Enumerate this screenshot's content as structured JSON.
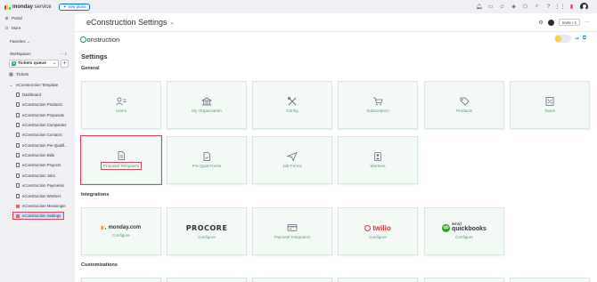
{
  "topbar": {
    "brand_bold": "monday",
    "brand_rest": " service",
    "see_plans": "See plans",
    "icons": [
      "bell-icon",
      "inbox-icon",
      "invite-members-icon",
      "integrations-icon",
      "apps-icon",
      "search-icon",
      "help-icon",
      "app-grid-icon"
    ]
  },
  "sidebar": {
    "portal": "Portal",
    "more": "More",
    "favorites": "Favorites",
    "workspaces": "Workspaces",
    "workspace_name": "Tickets queue",
    "workspace_badge": "S",
    "tickets": "Tickets",
    "template_folder": "eConstruction Template",
    "tree": [
      "Dashboard",
      "eConstruction Products",
      "eConstruction Proposals",
      "eConstruction Companies",
      "eConstruction Contacts",
      "eConstruction Pre-Qualif...",
      "eConstruction Bids",
      "eConstruction Projects",
      "eConstruction Jobs",
      "eConstruction Payments",
      "eConstruction Workers",
      "eConstruction Messenger",
      "eConstruction Settings"
    ]
  },
  "main": {
    "board_title": "eConstruction Settings",
    "invite_label": "Invite / 1",
    "app_logo_rest": "onstruction",
    "settings_heading": "Settings",
    "general_heading": "General",
    "integrations_heading": "Integrations",
    "customizations_heading": "Customizations",
    "general_cards": [
      {
        "label": "Users",
        "icon": "users-icon"
      },
      {
        "label": "My Organization",
        "icon": "organization-icon"
      },
      {
        "label": "Config",
        "icon": "tools-icon"
      },
      {
        "label": "Subscription",
        "icon": "cart-icon"
      },
      {
        "label": "Products",
        "icon": "tag-icon"
      },
      {
        "label": "Taxes",
        "icon": "taxes-icon"
      },
      {
        "label": "Proposal Templates",
        "icon": "document-icon"
      },
      {
        "label": "Pre-Qual Forms",
        "icon": "form-icon"
      },
      {
        "label": "Job Forms",
        "icon": "send-icon"
      },
      {
        "label": "Workers",
        "icon": "worker-icon"
      }
    ],
    "integration_cards": [
      {
        "brand": "monday.com",
        "label": "Configure"
      },
      {
        "brand": "PROCORE",
        "label": "Configure"
      },
      {
        "brand": "",
        "label": "Payment Integration"
      },
      {
        "brand": "twilio",
        "label": "Configure"
      },
      {
        "brand": "quickbooks",
        "brand_small": "INTUIT",
        "label": "Configure"
      }
    ]
  },
  "colors": {
    "accent": "#0073ea",
    "brand_green": "#00a359",
    "card_label": "#4a9e6b",
    "highlight": "#e2445c",
    "twilio": "#e22f3c",
    "quickbooks": "#2ca01c"
  }
}
